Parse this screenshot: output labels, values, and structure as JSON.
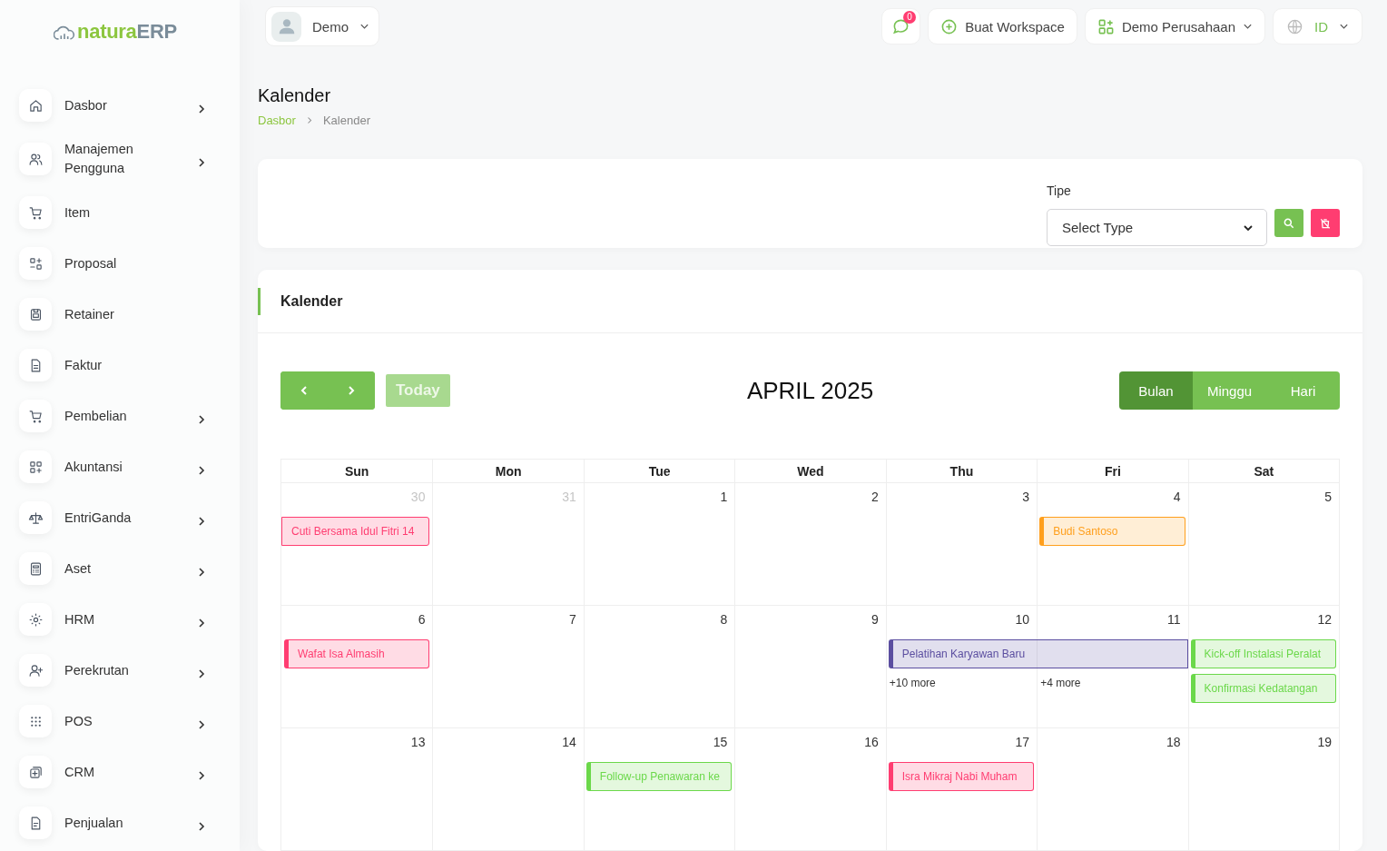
{
  "logo": {
    "brand_a": "natura",
    "brand_b": "ERP"
  },
  "user_menu": {
    "name": "Demo"
  },
  "topbar": {
    "chat_badge": "0",
    "workspace_button": "Buat Workspace",
    "company": "Demo Perusahaan",
    "language": "ID"
  },
  "sidebar": {
    "items": [
      {
        "label": "Dasbor",
        "has_submenu": true
      },
      {
        "label": "Manajemen Pengguna",
        "has_submenu": true
      },
      {
        "label": "Item",
        "has_submenu": false
      },
      {
        "label": "Proposal",
        "has_submenu": false
      },
      {
        "label": "Retainer",
        "has_submenu": false
      },
      {
        "label": "Faktur",
        "has_submenu": false
      },
      {
        "label": "Pembelian",
        "has_submenu": true
      },
      {
        "label": "Akuntansi",
        "has_submenu": true
      },
      {
        "label": "EntriGanda",
        "has_submenu": true
      },
      {
        "label": "Aset",
        "has_submenu": true
      },
      {
        "label": "HRM",
        "has_submenu": true
      },
      {
        "label": "Perekrutan",
        "has_submenu": true
      },
      {
        "label": "POS",
        "has_submenu": true
      },
      {
        "label": "CRM",
        "has_submenu": true
      },
      {
        "label": "Penjualan",
        "has_submenu": true
      }
    ]
  },
  "page": {
    "title": "Kalender",
    "breadcrumb": [
      {
        "label": "Dasbor",
        "link": true
      },
      {
        "label": "Kalender",
        "link": false
      }
    ]
  },
  "filter": {
    "label": "Tipe",
    "placeholder": "Select Type"
  },
  "calendar": {
    "card_title": "Kalender",
    "today_button": {
      "label": "Today",
      "disabled": true
    },
    "title": "APRIL 2025",
    "views": [
      {
        "label": "Bulan",
        "selected": true
      },
      {
        "label": "Minggu",
        "selected": false
      },
      {
        "label": "Hari",
        "selected": false
      }
    ],
    "weekdays": [
      "Sun",
      "Mon",
      "Tue",
      "Wed",
      "Thu",
      "Fri",
      "Sat"
    ],
    "weeks": [
      {
        "days": [
          {
            "number": "30",
            "other_month": true,
            "events": [
              {
                "title": "Cuti Bersama Idul Fitri 14",
                "color": "#ff3d71",
                "continues_before": true,
                "continues_after": false
              }
            ]
          },
          {
            "number": "31",
            "other_month": true
          },
          {
            "number": "1",
            "other_month": false
          },
          {
            "number": "2",
            "other_month": false
          },
          {
            "number": "3",
            "other_month": false
          },
          {
            "number": "4",
            "other_month": false,
            "events": [
              {
                "title": "Budi Santoso",
                "color": "#ff9f1c",
                "continues_before": false,
                "continues_after": false
              }
            ]
          },
          {
            "number": "5",
            "other_month": false
          }
        ]
      },
      {
        "days": [
          {
            "number": "6",
            "other_month": false,
            "events": [
              {
                "title": "Wafat Isa Almasih",
                "color": "#ff3d71",
                "continues_before": false,
                "continues_after": false
              }
            ]
          },
          {
            "number": "7",
            "other_month": false
          },
          {
            "number": "8",
            "other_month": false
          },
          {
            "number": "9",
            "other_month": false
          },
          {
            "number": "10",
            "other_month": false,
            "events": [
              {
                "title": "Pelatihan Karyawan Baru",
                "color": "#5b4ea0",
                "continues_before": false,
                "continues_after": true
              }
            ],
            "more": "+10 more"
          },
          {
            "number": "11",
            "other_month": false,
            "more": "+4 more"
          },
          {
            "number": "12",
            "other_month": false,
            "events": [
              {
                "title": "Kick-off Instalasi Peralat",
                "color": "#6bd84a",
                "continues_before": false,
                "continues_after": false
              },
              {
                "title": "Konfirmasi Kedatangan",
                "color": "#6bd84a",
                "continues_before": false,
                "continues_after": false
              }
            ]
          }
        ]
      },
      {
        "days": [
          {
            "number": "13",
            "other_month": false
          },
          {
            "number": "14",
            "other_month": false
          },
          {
            "number": "15",
            "other_month": false,
            "events": [
              {
                "title": "Follow-up Penawaran ke",
                "color": "#6bd84a",
                "continues_before": false,
                "continues_after": false
              }
            ]
          },
          {
            "number": "16",
            "other_month": false
          },
          {
            "number": "17",
            "other_month": false,
            "events": [
              {
                "title": "Isra Mikraj Nabi Muham",
                "color": "#ff3d71",
                "continues_before": false,
                "continues_after": false
              }
            ]
          },
          {
            "number": "18",
            "other_month": false
          },
          {
            "number": "19",
            "other_month": false
          }
        ]
      }
    ]
  }
}
